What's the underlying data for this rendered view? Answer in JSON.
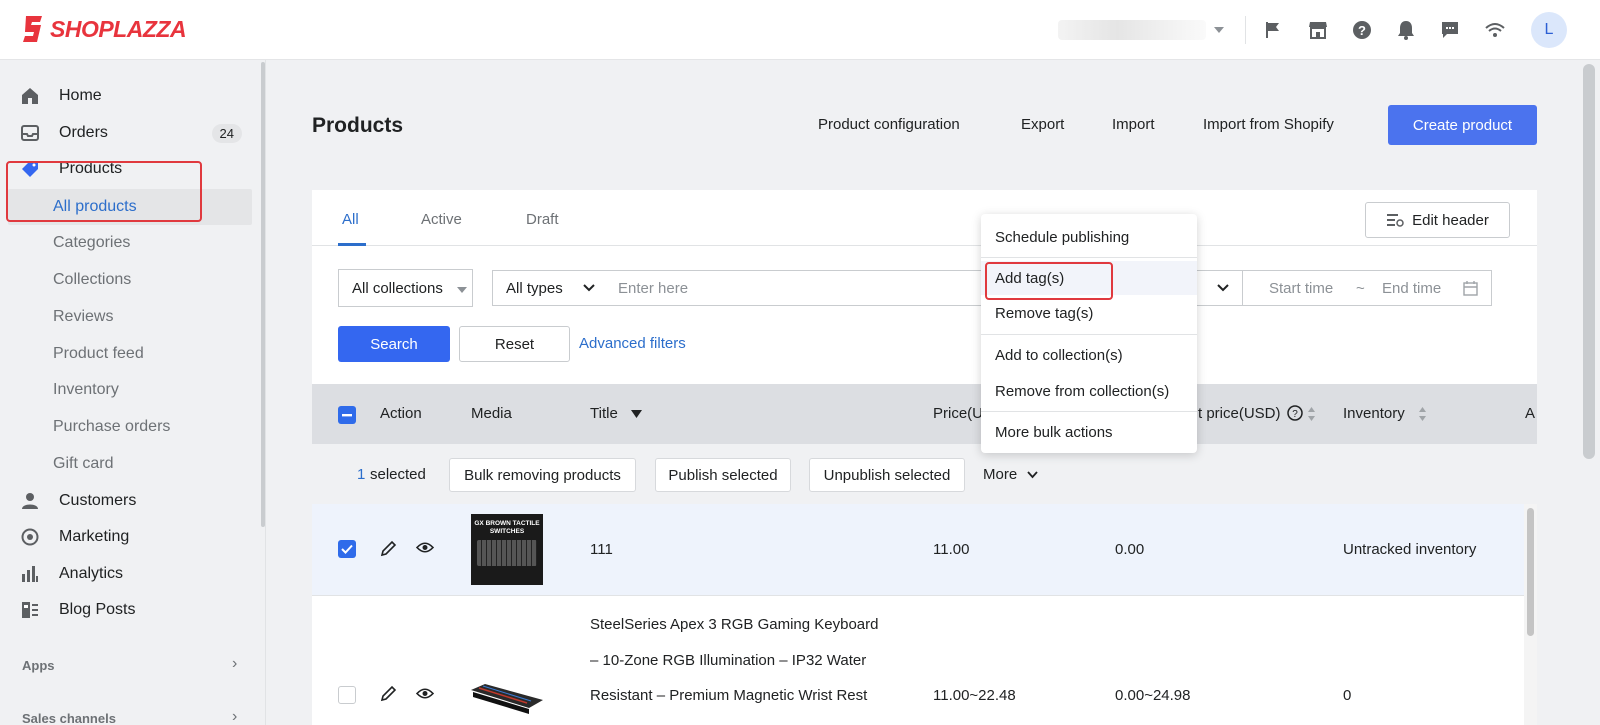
{
  "brand": {
    "name": "SHOPLAZZA",
    "color": "#e8343d"
  },
  "topbar": {
    "icons": [
      "flag-icon",
      "store-icon",
      "help-icon",
      "bell-icon",
      "chat-icon",
      "wifi-icon"
    ],
    "avatar_letter": "L"
  },
  "sidebar": {
    "home": "Home",
    "orders": "Orders",
    "orders_badge": "24",
    "products": "Products",
    "sub": [
      "All products",
      "Categories",
      "Collections",
      "Reviews",
      "Product feed",
      "Inventory",
      "Purchase orders",
      "Gift card"
    ],
    "customers": "Customers",
    "marketing": "Marketing",
    "analytics": "Analytics",
    "blog_posts": "Blog Posts",
    "apps": "Apps",
    "sales_channels": "Sales channels"
  },
  "header": {
    "title": "Products",
    "product_configuration": "Product configuration",
    "export": "Export",
    "import": "Import",
    "import_shopify": "Import from Shopify",
    "create": "Create product"
  },
  "tabs": [
    "All",
    "Active",
    "Draft"
  ],
  "edit_header": "Edit header",
  "filters": {
    "collections": "All collections",
    "types": "All types",
    "input_placeholder": "Enter here",
    "start_time": "Start time",
    "tilde": "~",
    "end_time": "End time",
    "search": "Search",
    "reset": "Reset",
    "advanced": "Advanced filters"
  },
  "table": {
    "headers": {
      "action": "Action",
      "media": "Media",
      "title": "Title",
      "price": "Price(U",
      "compare_price": "t price(USD)",
      "inventory": "Inventory",
      "extra": "A"
    },
    "selected_count": "1",
    "selected_label": "selected",
    "bulk": [
      "Bulk removing products",
      "Publish selected",
      "Unpublish selected"
    ],
    "more": "More",
    "rows": [
      {
        "title": "111",
        "price": "11.00",
        "compare": "0.00",
        "inventory": "Untracked inventory",
        "media_text": "GX BROWN TACTILE SWITCHES"
      },
      {
        "title_lines": [
          "SteelSeries Apex 3 RGB Gaming Keyboard",
          "– 10-Zone RGB Illumination – IP32 Water",
          "Resistant – Premium Magnetic Wrist Rest"
        ],
        "price": "11.00~22.48",
        "compare": "0.00~24.98",
        "inventory": "0"
      }
    ]
  },
  "bulk_menu": [
    "Schedule publishing",
    "Add tag(s)",
    "Remove tag(s)",
    "Add to collection(s)",
    "Remove from collection(s)",
    "More bulk actions"
  ],
  "colors": {
    "primary": "#3467f0",
    "link": "#2c6ecb",
    "highlight": "#e0393e"
  }
}
